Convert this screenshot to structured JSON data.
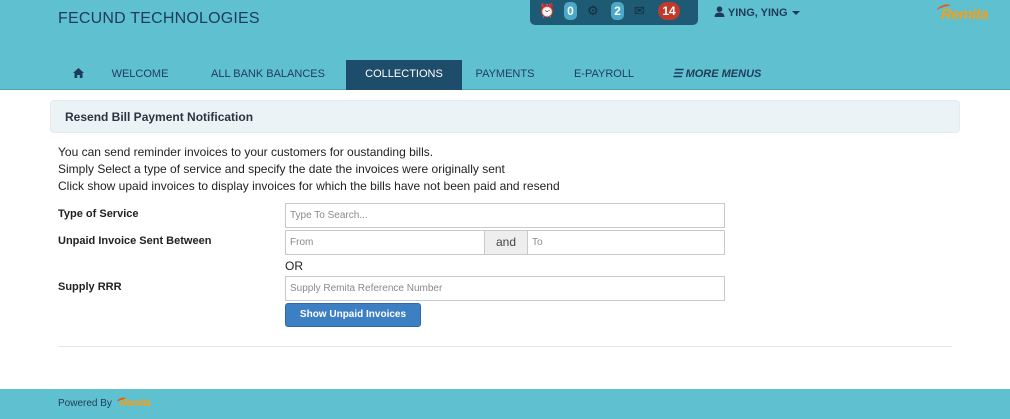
{
  "brand": {
    "name": "FECUND TECHNOLOGIES"
  },
  "notifications": [
    {
      "icon": "clock-icon",
      "glyph": "⏰",
      "count": "0",
      "color": "#4aa9c9"
    },
    {
      "icon": "gear-icon",
      "glyph": "⚙",
      "count": "2",
      "color": "#4aa9c9"
    },
    {
      "icon": "envelope-icon",
      "glyph": "✉",
      "count": "14",
      "color": "#c0392b"
    }
  ],
  "user": {
    "name": "YING, YING",
    "icon": "user-icon"
  },
  "logo": {
    "text": "Remita",
    "color": "#f4a019"
  },
  "nav": {
    "home_icon": "home-icon",
    "items": [
      {
        "label": "WELCOME",
        "active": false
      },
      {
        "label": "ALL BANK BALANCES",
        "active": false
      },
      {
        "label": "COLLECTIONS",
        "active": true
      },
      {
        "label": "PAYMENTS",
        "active": false
      },
      {
        "label": "E-PAYROLL",
        "active": false
      }
    ],
    "more": {
      "label": "MORE MENUS",
      "icon": "hamburger-icon"
    }
  },
  "panel": {
    "title": "Resend Bill Payment Notification"
  },
  "intro": [
    "You can send reminder invoices to your customers for oustanding bills.",
    "Simply Select a type of service and specify the date the invoices were originally sent",
    "Click show upaid invoices to display invoices for which the bills have not been paid and resend"
  ],
  "form": {
    "service_label": "Type of Service",
    "service_placeholder": "Type To Search...",
    "date_label": "Unpaid Invoice Sent Between",
    "from_placeholder": "From",
    "and_label": "and",
    "to_placeholder": "To",
    "or_label": "OR",
    "rrr_label": "Supply RRR",
    "rrr_placeholder": "Supply Remita Reference Number",
    "submit_label": "Show Unpaid Invoices"
  },
  "footer": {
    "powered_by": "Powered By",
    "logo_text": "Remita"
  },
  "colors": {
    "header": "#5fc0cf",
    "nav_active": "#1e4d6b",
    "button": "#3c7fc2",
    "logo": "#f4a019"
  }
}
